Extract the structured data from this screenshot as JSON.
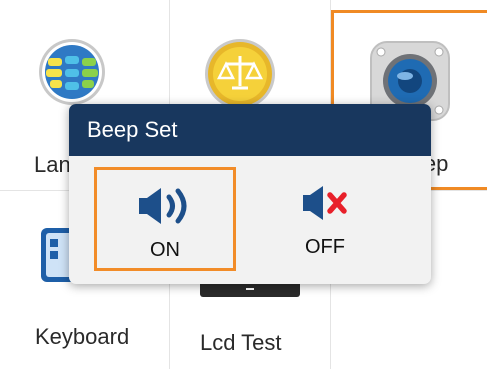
{
  "tiles": {
    "language_label": "Language",
    "keyboard_label": "Keyboard",
    "lcd_test_label": "Lcd Test",
    "beep_label": "Beep"
  },
  "dialog": {
    "title": "Beep Set",
    "options": [
      {
        "label": "ON",
        "icon": "speaker-on-icon",
        "selected": true
      },
      {
        "label": "OFF",
        "icon": "speaker-mute-icon",
        "selected": false
      }
    ]
  },
  "colors": {
    "dialog_header": "#18375e",
    "selection_border": "#f28c28",
    "icon_blue": "#1d4f8a",
    "mute_red": "#e8202a"
  }
}
